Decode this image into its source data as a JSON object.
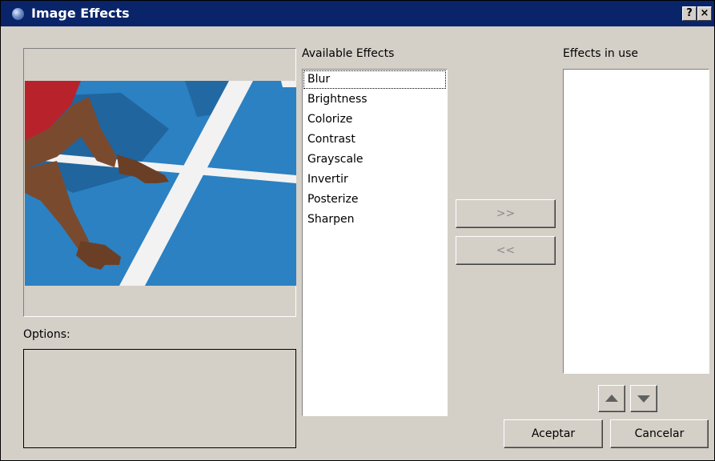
{
  "window": {
    "title": "Image Effects",
    "help_label": "?",
    "close_label": "×"
  },
  "preview": {
    "image": "runner-hands-on-blue-track"
  },
  "options": {
    "label": "Options:"
  },
  "available_effects": {
    "label": "Available Effects",
    "items": [
      "Blur",
      "Brightness",
      "Colorize",
      "Contrast",
      "Grayscale",
      "Invertir",
      "Posterize",
      "Sharpen"
    ],
    "focused": "Blur"
  },
  "effects_in_use": {
    "label": "Effects in use",
    "items": []
  },
  "buttons": {
    "add": ">>",
    "remove": "<<",
    "move_up": "up-arrow-icon",
    "move_down": "down-arrow-icon",
    "ok": "Aceptar",
    "cancel": "Cancelar"
  },
  "colors": {
    "titlebar": "#0a246a",
    "dialog_bg": "#d4d0c8",
    "track_blue": "#2e86c8"
  }
}
